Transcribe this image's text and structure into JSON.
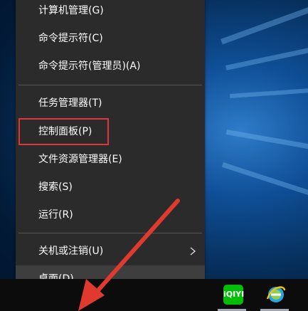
{
  "menu": {
    "items": [
      {
        "label": "计算机管理(G)"
      },
      {
        "label": "命令提示符(C)"
      },
      {
        "label": "命令提示符(管理员)(A)"
      },
      {
        "label": "任务管理器(T)"
      },
      {
        "label": "控制面板(P)"
      },
      {
        "label": "文件资源管理器(E)"
      },
      {
        "label": "搜索(S)"
      },
      {
        "label": "运行(R)"
      },
      {
        "label": "关机或注销(U)"
      },
      {
        "label": "桌面(D)"
      }
    ],
    "highlighted_item": "控制面板(P)",
    "submenu_icon": "chevron-right-icon"
  },
  "taskbar": {
    "apps": [
      {
        "icon": "iqiyi-icon",
        "text": "iQIYI"
      },
      {
        "icon": "ie-browser-icon"
      }
    ]
  },
  "colors": {
    "menu_bg": "#2b2b2b",
    "highlight_box": "#d63a3a",
    "annotation_arrow": "#e03a2f",
    "iqiyi_green": "#00be06"
  }
}
